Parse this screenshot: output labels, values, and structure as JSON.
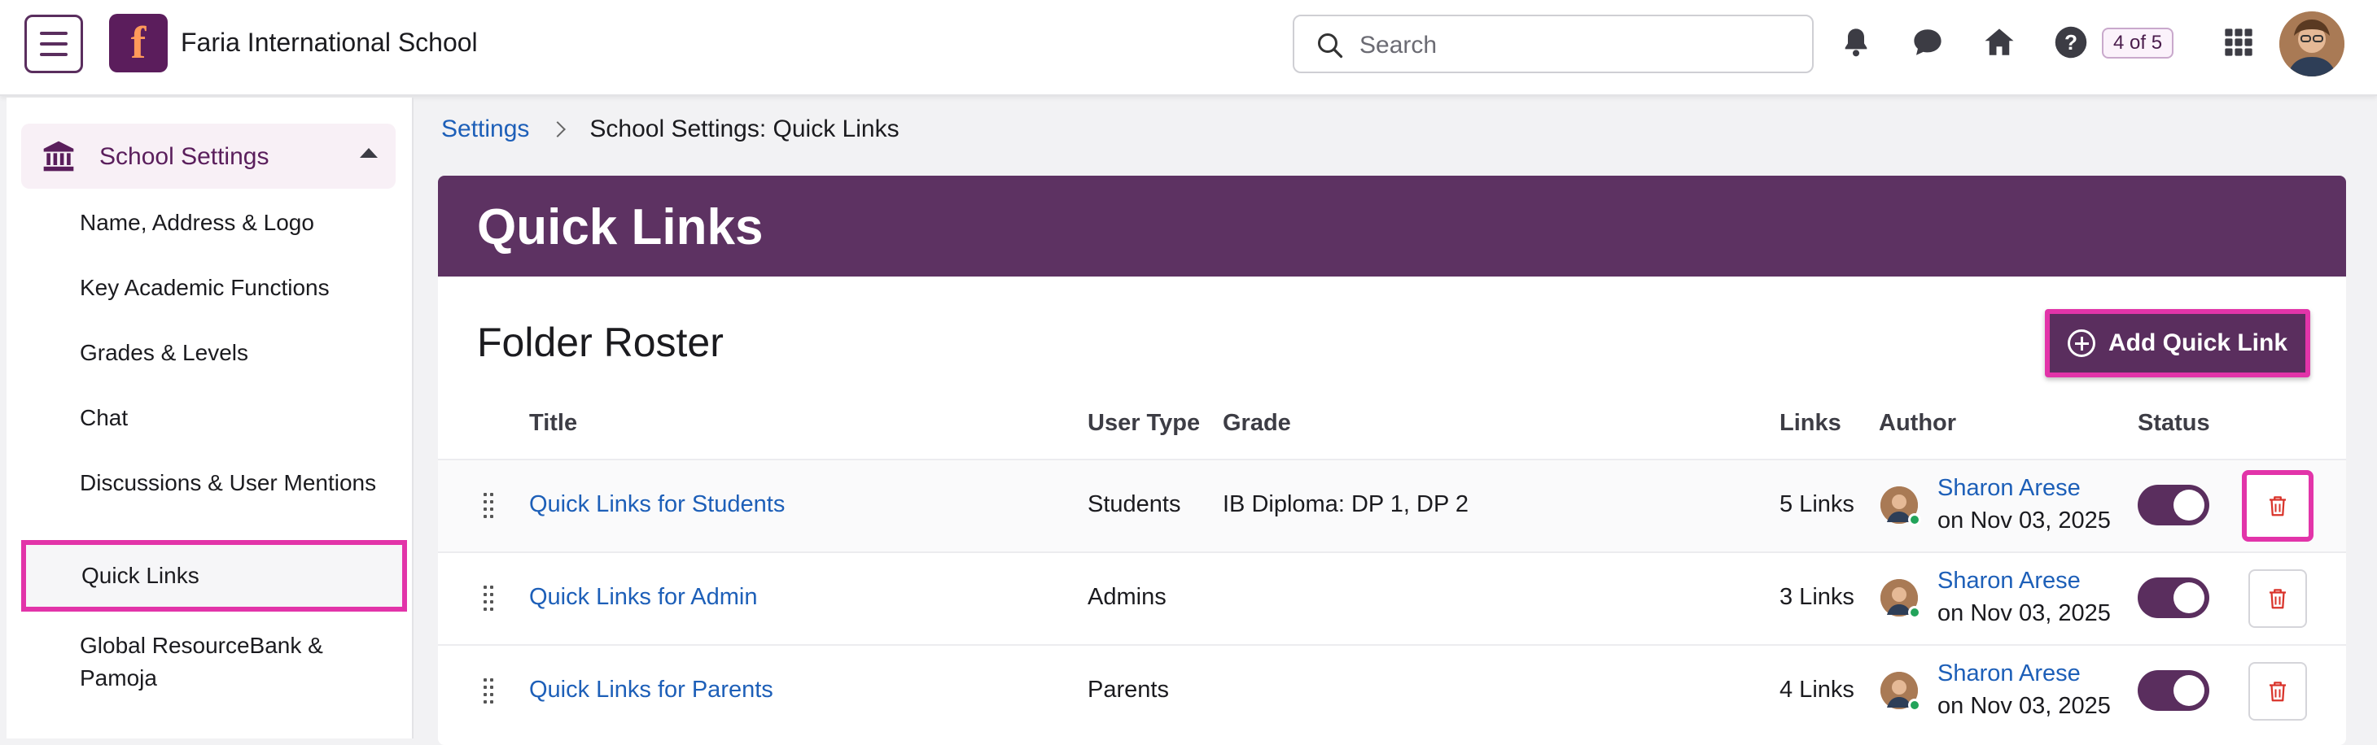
{
  "header": {
    "school_name": "Faria International School",
    "logo_letter": "f",
    "search_placeholder": "Search",
    "pager": "4 of 5",
    "icons": [
      "bell-icon",
      "chat-icon",
      "home-icon",
      "help-icon",
      "apps-grid-icon"
    ]
  },
  "sidebar": {
    "group_label": "School Settings",
    "items": [
      {
        "label": "Name, Address & Logo"
      },
      {
        "label": "Key Academic Functions"
      },
      {
        "label": "Grades & Levels"
      },
      {
        "label": "Chat"
      },
      {
        "label": "Discussions & User Mentions"
      },
      {
        "label": "Quick Links",
        "active": true
      },
      {
        "label": "Global ResourceBank & Pamoja"
      }
    ]
  },
  "breadcrumb": {
    "root": "Settings",
    "current": "School Settings: Quick Links"
  },
  "page": {
    "title": "Quick Links",
    "section_title": "Folder Roster",
    "add_button": "Add Quick Link"
  },
  "table": {
    "columns": {
      "title": "Title",
      "user_type": "User Type",
      "grade": "Grade",
      "links": "Links",
      "author": "Author",
      "status": "Status"
    },
    "rows": [
      {
        "title": "Quick Links for Students",
        "user_type": "Students",
        "grade": "IB Diploma: DP 1, DP 2",
        "links": "5 Links",
        "author": "Sharon Arese",
        "date": "on Nov 03, 2025",
        "enabled": true
      },
      {
        "title": "Quick Links for Admin",
        "user_type": "Admins",
        "grade": "",
        "links": "3 Links",
        "author": "Sharon Arese",
        "date": "on Nov 03, 2025",
        "enabled": true
      },
      {
        "title": "Quick Links for Parents",
        "user_type": "Parents",
        "grade": "",
        "links": "4 Links",
        "author": "Sharon Arese",
        "date": "on Nov 03, 2025",
        "enabled": true
      }
    ]
  },
  "colors": {
    "brand": "#5a2e5e",
    "highlight": "#e234a9",
    "link": "#1d5fb8",
    "danger": "#d9332a"
  }
}
